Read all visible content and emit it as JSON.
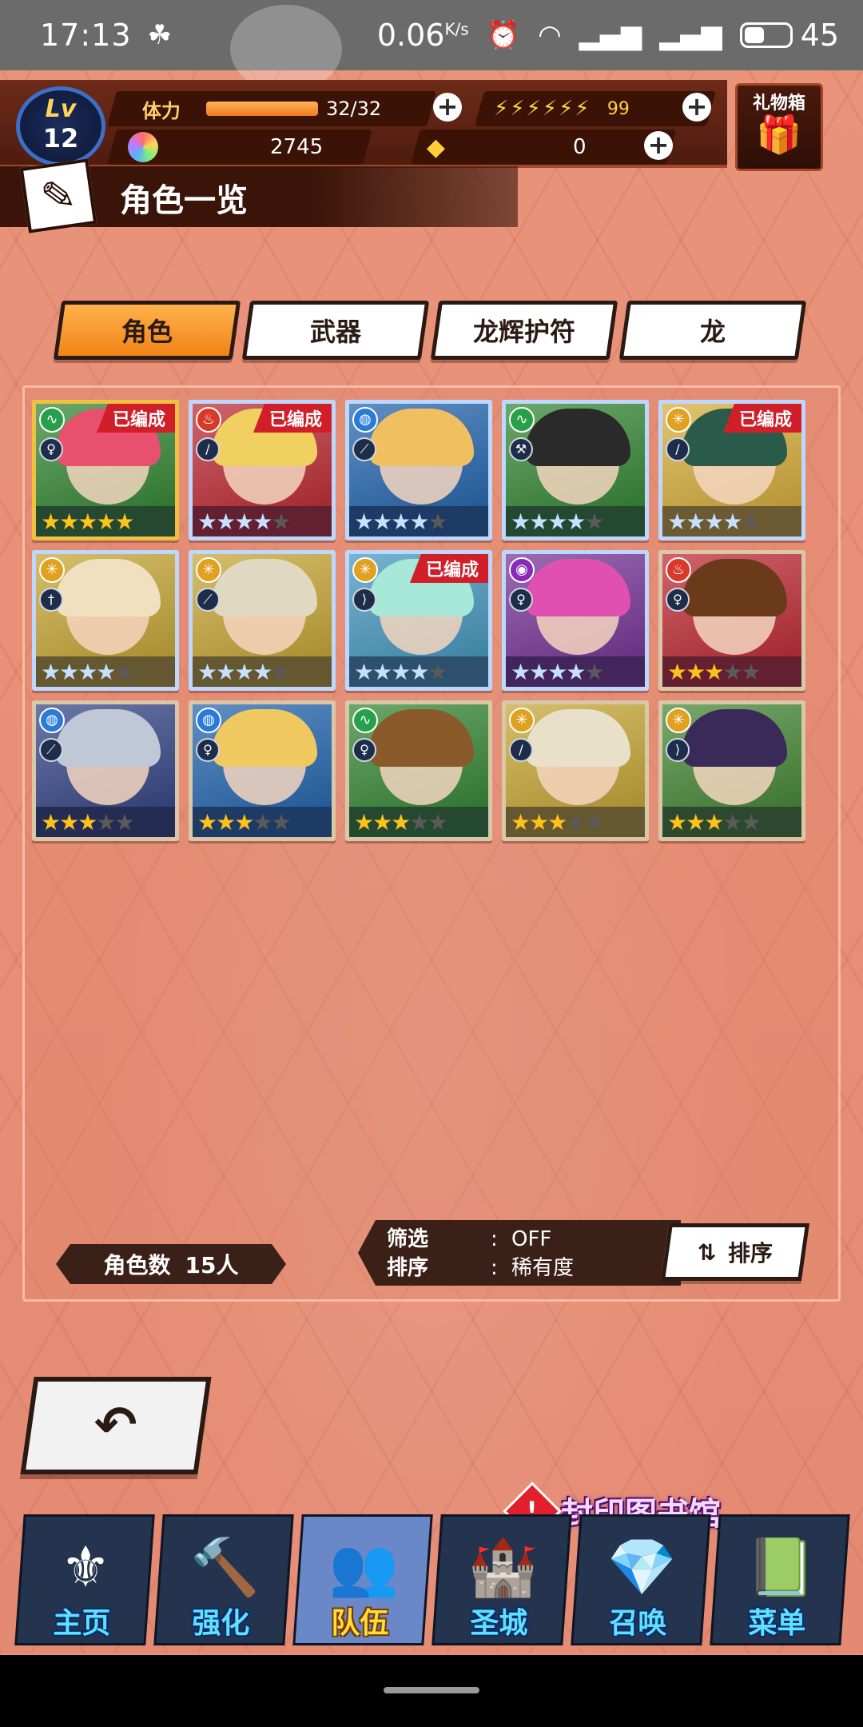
{
  "status_bar": {
    "time": "17:13",
    "speed": "0.06",
    "speed_unit": "K/s",
    "battery": "45",
    "battery_level": 0.45
  },
  "player": {
    "level_label": "Lv",
    "level": "12",
    "stamina_label": "体力",
    "stamina_value": "32/32",
    "stamina_fraction": 1.0,
    "wings_value": "99",
    "rupies": "2745",
    "gems": "0"
  },
  "gift_box": {
    "label": "礼物箱"
  },
  "page_title": "角色一览",
  "tabs": [
    {
      "label": "角色",
      "active": true
    },
    {
      "label": "武器",
      "active": false
    },
    {
      "label": "龙辉护符",
      "active": false
    },
    {
      "label": "龙",
      "active": false
    }
  ],
  "characters": [
    {
      "element": "wind",
      "weapon": "staff",
      "stars": 5,
      "rarity_color": "gold",
      "in_team": true,
      "badge": "已编成",
      "hair": "#e8506e",
      "bg": "#3a8a3a"
    },
    {
      "element": "flame",
      "weapon": "sword",
      "stars": 4,
      "rarity_color": "blue",
      "in_team": true,
      "badge": "已编成",
      "hair": "#f0d060",
      "bg": "#c0303a"
    },
    {
      "element": "water",
      "weapon": "lance",
      "stars": 4,
      "rarity_color": "blue",
      "in_team": false,
      "badge": "",
      "hair": "#f0c060",
      "bg": "#2a6ab0"
    },
    {
      "element": "wind",
      "weapon": "axe",
      "stars": 4,
      "rarity_color": "blue",
      "in_team": false,
      "badge": "",
      "hair": "#2a2a2a",
      "bg": "#3a8a3a"
    },
    {
      "element": "light",
      "weapon": "sword",
      "stars": 4,
      "rarity_color": "blue",
      "in_team": true,
      "badge": "已编成",
      "hair": "#2a5a4a",
      "bg": "#d8b040"
    },
    {
      "element": "light",
      "weapon": "dagger",
      "stars": 4,
      "rarity_color": "blue",
      "in_team": false,
      "badge": "",
      "hair": "#f0e0c0",
      "bg": "#c8a83a"
    },
    {
      "element": "light",
      "weapon": "lance",
      "stars": 4,
      "rarity_color": "blue",
      "in_team": false,
      "badge": "",
      "hair": "#e0d8c0",
      "bg": "#c8a83a"
    },
    {
      "element": "light",
      "weapon": "bow",
      "stars": 4,
      "rarity_color": "blue",
      "in_team": true,
      "badge": "已编成",
      "hair": "#a8e8d8",
      "bg": "#4a9ac0"
    },
    {
      "element": "shadow",
      "weapon": "wand",
      "stars": 4,
      "rarity_color": "blue",
      "in_team": false,
      "badge": "",
      "hair": "#e050b0",
      "bg": "#7a3a9a"
    },
    {
      "element": "flame",
      "weapon": "wand",
      "stars": 3,
      "rarity_color": "gold",
      "in_team": false,
      "badge": "",
      "hair": "#6a3a1a",
      "bg": "#c0303a"
    },
    {
      "element": "water",
      "weapon": "lance",
      "stars": 3,
      "rarity_color": "gold",
      "in_team": false,
      "badge": "",
      "hair": "#c0c8d8",
      "bg": "#3a4a8a"
    },
    {
      "element": "water",
      "weapon": "wand",
      "stars": 3,
      "rarity_color": "gold",
      "in_team": false,
      "badge": "",
      "hair": "#f0c860",
      "bg": "#2a6ab0"
    },
    {
      "element": "wind",
      "weapon": "staff",
      "stars": 3,
      "rarity_color": "gold",
      "in_team": false,
      "badge": "",
      "hair": "#8a5a2a",
      "bg": "#3a8a3a"
    },
    {
      "element": "light",
      "weapon": "sword",
      "stars": 3,
      "rarity_color": "gold",
      "in_team": false,
      "badge": "",
      "hair": "#e8e0c8",
      "bg": "#c8a83a"
    },
    {
      "element": "light",
      "weapon": "bow",
      "stars": 3,
      "rarity_color": "gold",
      "in_team": false,
      "badge": "",
      "hair": "#3a2a5a",
      "bg": "#4a8a3a"
    }
  ],
  "summary": {
    "count_label": "角色数",
    "count_value": "15人",
    "filter_label": "筛选",
    "filter_value": "OFF",
    "sort_label": "排序",
    "sort_value": "稀有度",
    "sort_button": "排序"
  },
  "library_notice": "封印图书馆",
  "bottom_nav": [
    {
      "label": "主页",
      "icon": "home-emblem-icon",
      "active": false
    },
    {
      "label": "强化",
      "icon": "hammer-icon",
      "active": false
    },
    {
      "label": "队伍",
      "icon": "team-portrait-icon",
      "active": true
    },
    {
      "label": "圣城",
      "icon": "castle-icon",
      "active": false
    },
    {
      "label": "召唤",
      "icon": "crystal-icon",
      "active": false
    },
    {
      "label": "菜单",
      "icon": "book-icon",
      "active": false
    }
  ]
}
